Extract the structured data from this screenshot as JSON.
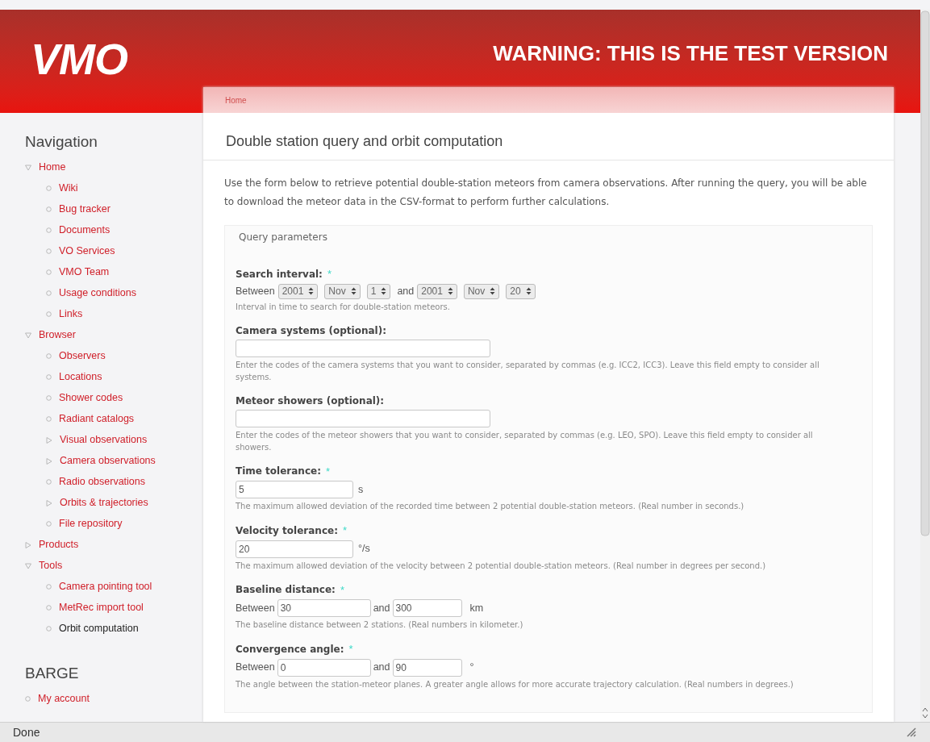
{
  "header": {
    "logo": "VMO",
    "warning": "WARNING: THIS IS THE TEST VERSION"
  },
  "breadcrumb": "Home",
  "sidebar": {
    "sections": [
      {
        "title": "Navigation",
        "items": [
          {
            "label": "Home",
            "kind": "expanded",
            "selected": false,
            "children": [
              {
                "label": "Wiki",
                "kind": "leaf",
                "selected": false
              },
              {
                "label": "Bug tracker",
                "kind": "leaf",
                "selected": false
              },
              {
                "label": "Documents",
                "kind": "leaf",
                "selected": false
              },
              {
                "label": "VO Services",
                "kind": "leaf",
                "selected": false
              },
              {
                "label": "VMO Team",
                "kind": "leaf",
                "selected": false
              },
              {
                "label": "Usage conditions",
                "kind": "leaf",
                "selected": false
              },
              {
                "label": "Links",
                "kind": "leaf",
                "selected": false
              }
            ]
          },
          {
            "label": "Browser",
            "kind": "expanded",
            "selected": false,
            "children": [
              {
                "label": "Observers",
                "kind": "leaf",
                "selected": false
              },
              {
                "label": "Locations",
                "kind": "leaf",
                "selected": false
              },
              {
                "label": "Shower codes",
                "kind": "leaf",
                "selected": false
              },
              {
                "label": "Radiant catalogs",
                "kind": "leaf",
                "selected": false
              },
              {
                "label": "Visual observations",
                "kind": "collapsed",
                "selected": false
              },
              {
                "label": "Camera observations",
                "kind": "collapsed",
                "selected": false
              },
              {
                "label": "Radio observations",
                "kind": "leaf",
                "selected": false
              },
              {
                "label": "Orbits & trajectories",
                "kind": "collapsed",
                "selected": false
              },
              {
                "label": "File repository",
                "kind": "leaf",
                "selected": false
              }
            ]
          },
          {
            "label": "Products",
            "kind": "collapsed",
            "selected": false
          },
          {
            "label": "Tools",
            "kind": "expanded",
            "selected": false,
            "children": [
              {
                "label": "Camera pointing tool",
                "kind": "leaf",
                "selected": false
              },
              {
                "label": "MetRec import tool",
                "kind": "leaf",
                "selected": false
              },
              {
                "label": "Orbit computation",
                "kind": "leaf",
                "selected": true
              }
            ]
          }
        ]
      },
      {
        "title": "BARGE",
        "items": [
          {
            "label": "My account",
            "kind": "leaf",
            "selected": false
          }
        ]
      }
    ]
  },
  "page": {
    "title": "Double station query and orbit computation",
    "intro": "Use the form below to retrieve potential double-station meteors from camera observations. After running the query, you will be able to download the meteor data in the CSV-format to perform further calculations.",
    "fieldset": {
      "legend": "Query parameters",
      "fields": [
        {
          "kind": "selects",
          "label": "Search interval:",
          "required_mark": "*",
          "prefix": "Between",
          "start": [
            "2001",
            "Nov",
            "1"
          ],
          "joiner": "and",
          "end": [
            "2001",
            "Nov",
            "20"
          ],
          "help": "Interval in time to search for double-station meteors."
        },
        {
          "kind": "text",
          "label": "Camera systems (optional):",
          "help": "Enter the codes of the camera systems that you want to consider, separated by commas (e.g. ICC2, ICC3). Leave this field empty to consider all systems."
        },
        {
          "kind": "text",
          "label": "Meteor showers (optional):",
          "help": "Enter the codes of the meteor showers that you want to consider, separated by commas (e.g. LEO, SPO). Leave this field empty to consider all showers."
        },
        {
          "kind": "number",
          "label": "Time tolerance:",
          "required_mark": "*",
          "value": "5",
          "unit": "s",
          "help": "The maximum allowed deviation of the recorded time between 2 potential double-station meteors. (Real number in seconds.)"
        },
        {
          "kind": "number",
          "label": "Velocity tolerance:",
          "required_mark": "*",
          "value": "20",
          "unit": "°/s",
          "help": "The maximum allowed deviation of the velocity between 2 potential double-station meteors. (Real number in degrees per second.)"
        },
        {
          "kind": "range",
          "label": "Baseline distance:",
          "required_mark": "*",
          "prefix": "Between",
          "from": "30",
          "joiner": "and",
          "to": "300",
          "unit": "km",
          "help": "The baseline distance between 2 stations. (Real numbers in kilometer.)"
        },
        {
          "kind": "range",
          "label": "Convergence angle:",
          "required_mark": "*",
          "prefix": "Between",
          "from": "0",
          "joiner": "and",
          "to": "90",
          "unit": "°",
          "help": "The angle between the station-meteor planes. A greater angle allows for more accurate trajectory calculation. (Real numbers in degrees.)"
        }
      ]
    }
  },
  "status_bar": {
    "text": "Done"
  }
}
